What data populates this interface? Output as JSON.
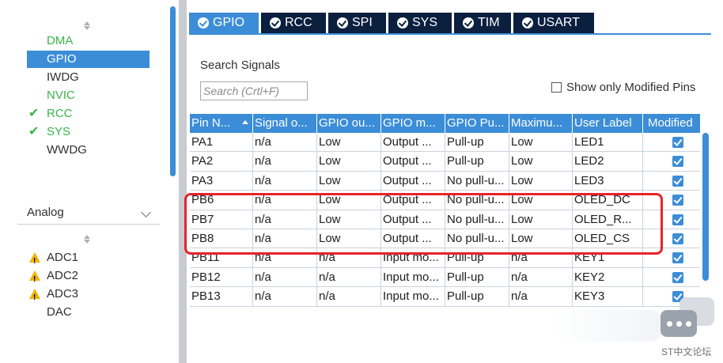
{
  "sidebar": {
    "items": [
      {
        "label": "DMA",
        "status": "green"
      },
      {
        "label": "GPIO",
        "status": "selected"
      },
      {
        "label": "IWDG",
        "status": "normal"
      },
      {
        "label": "NVIC",
        "status": "green"
      },
      {
        "label": "RCC",
        "status": "checked"
      },
      {
        "label": "SYS",
        "status": "checked"
      },
      {
        "label": "WWDG",
        "status": "normal"
      }
    ],
    "analog_label": "Analog",
    "analog_items": [
      {
        "label": "ADC1",
        "status": "warning"
      },
      {
        "label": "ADC2",
        "status": "warning"
      },
      {
        "label": "ADC3",
        "status": "warning"
      },
      {
        "label": "DAC",
        "status": "normal"
      }
    ]
  },
  "tabs": [
    {
      "label": "GPIO",
      "active": true
    },
    {
      "label": "RCC",
      "active": false
    },
    {
      "label": "SPI",
      "active": false
    },
    {
      "label": "SYS",
      "active": false
    },
    {
      "label": "TIM",
      "active": false
    },
    {
      "label": "USART",
      "active": false
    }
  ],
  "search": {
    "label": "Search Signals",
    "placeholder": "Search (Crtl+F)"
  },
  "show_modified": {
    "label": "Show only Modified Pins",
    "checked": false
  },
  "table": {
    "headers": [
      "Pin N...",
      "Signal o...",
      "GPIO ou...",
      "GPIO m...",
      "GPIO Pu...",
      "Maximu...",
      "User Label",
      "Modified"
    ],
    "rows": [
      [
        "PA1",
        "n/a",
        "Low",
        "Output ...",
        "Pull-up",
        "Low",
        "LED1",
        true
      ],
      [
        "PA2",
        "n/a",
        "Low",
        "Output ...",
        "Pull-up",
        "Low",
        "LED2",
        true
      ],
      [
        "PA3",
        "n/a",
        "Low",
        "Output ...",
        "No pull-u...",
        "Low",
        "LED3",
        true
      ],
      [
        "PB6",
        "n/a",
        "Low",
        "Output ...",
        "No pull-u...",
        "Low",
        "OLED_DC",
        true
      ],
      [
        "PB7",
        "n/a",
        "Low",
        "Output ...",
        "No pull-u...",
        "Low",
        "OLED_R...",
        true
      ],
      [
        "PB8",
        "n/a",
        "Low",
        "Output ...",
        "No pull-u...",
        "Low",
        "OLED_CS",
        true
      ],
      [
        "PB11",
        "n/a",
        "n/a",
        "Input mo...",
        "Pull-up",
        "n/a",
        "KEY1",
        true
      ],
      [
        "PB12",
        "n/a",
        "n/a",
        "Input mo...",
        "Pull-up",
        "n/a",
        "KEY2",
        true
      ],
      [
        "PB13",
        "n/a",
        "n/a",
        "Input mo...",
        "Pull-up",
        "n/a",
        "KEY3",
        true
      ]
    ]
  },
  "watermark": "ST中文论坛",
  "colors": {
    "accent": "#3c8dd7",
    "tab_dark": "#0b1f3f",
    "green": "#39b54a",
    "highlight": "#e8222b"
  }
}
